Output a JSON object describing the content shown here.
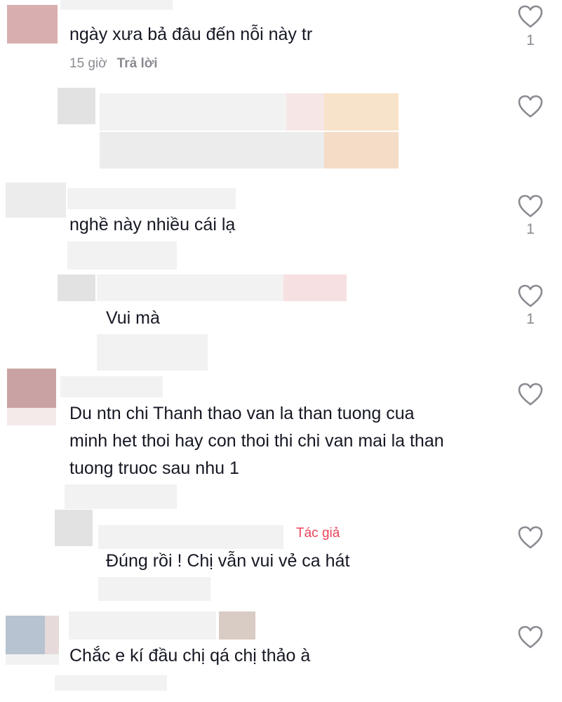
{
  "comments": [
    {
      "text": "ngày xưa bả đâu đến nỗi này tr",
      "time": "15 giờ",
      "reply_label": "Trả lời",
      "likes": "1"
    },
    {
      "text": "",
      "likes": ""
    },
    {
      "text": "nghề này nhiều cái lạ",
      "likes": "1"
    },
    {
      "text": "Vui mà",
      "likes": "1"
    },
    {
      "lines": [
        "Du ntn chi Thanh thao van la than tuong cua",
        "minh het thoi hay con thoi thi chi van mai la than",
        "tuong truoc sau nhu 1"
      ],
      "likes": ""
    },
    {
      "text": "Đúng rồi ! Chị vẫn vui vẻ ca hát",
      "author_badge": "Tác giả",
      "likes": ""
    },
    {
      "text": "Chắc e kí đầu chị qá chị thảo à",
      "likes": ""
    }
  ],
  "colors": {
    "text": "#161823",
    "muted": "#8a8b91",
    "author_badge": "#e8445a"
  },
  "icons": {
    "like": "heart-outline-icon"
  }
}
